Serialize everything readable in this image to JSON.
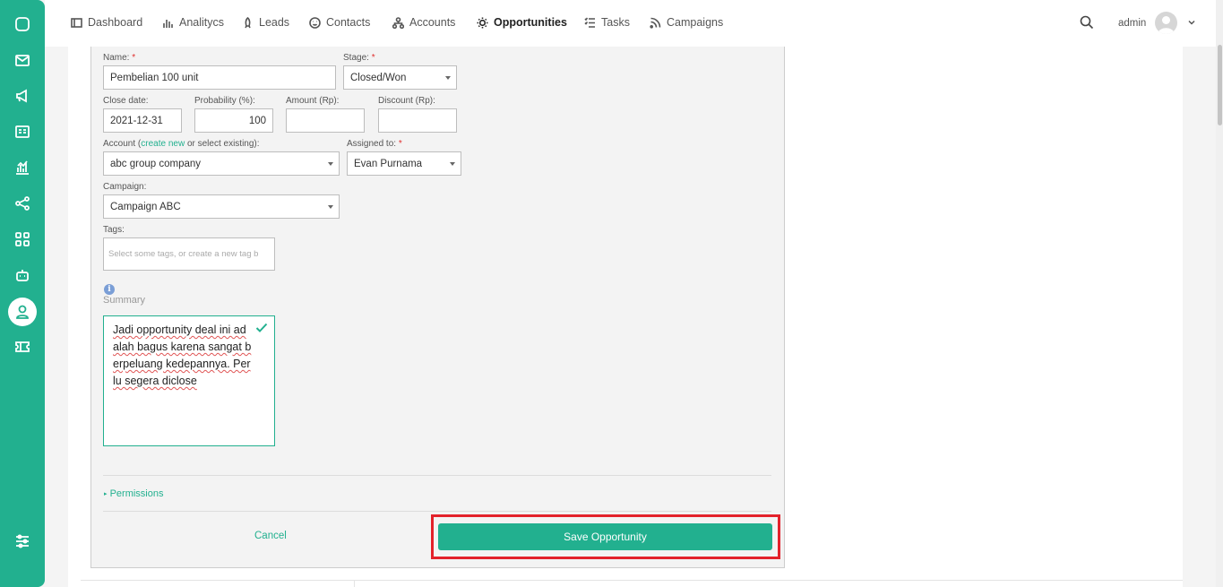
{
  "nav": {
    "items": [
      {
        "label": "Dashboard",
        "icon": "layout-icon"
      },
      {
        "label": "Analitycs",
        "icon": "bar-chart-icon"
      },
      {
        "label": "Leads",
        "icon": "rocket-icon"
      },
      {
        "label": "Contacts",
        "icon": "smiley-icon"
      },
      {
        "label": "Accounts",
        "icon": "hierarchy-icon"
      },
      {
        "label": "Opportunities",
        "icon": "sun-icon",
        "active": true
      },
      {
        "label": "Tasks",
        "icon": "checklist-icon"
      },
      {
        "label": "Campaigns",
        "icon": "rss-icon"
      }
    ],
    "user": "admin"
  },
  "sidebar": {
    "icons": [
      "chat-icon",
      "mail-icon",
      "megaphone-icon",
      "id-card-icon",
      "chart-icon",
      "share-icon",
      "apps-icon",
      "robot-icon",
      "user-icon",
      "ticket-icon",
      "settings-sliders-icon"
    ],
    "active": "user-icon"
  },
  "form": {
    "name_label": "Name:",
    "name_value": "Pembelian 100 unit",
    "stage_label": "Stage:",
    "stage_value": "Closed/Won",
    "close_date_label": "Close date:",
    "close_date_value": "2021-12-31",
    "probability_label": "Probability (%):",
    "probability_value": "100",
    "amount_label": "Amount (Rp):",
    "amount_value": "",
    "discount_label": "Discount (Rp):",
    "discount_value": "",
    "account_label_prefix": "Account (",
    "account_label_link": "create new",
    "account_label_suffix": " or select existing):",
    "account_value": "abc group company",
    "assigned_label": "Assigned to:",
    "assigned_value": "Evan Purnama",
    "campaign_label": "Campaign:",
    "campaign_value": "Campaign ABC",
    "tags_label": "Tags:",
    "tags_placeholder": "Select some tags, or create a new tag b",
    "summary_label": "Summary",
    "summary_text": "Jadi opportunity deal ini adalah bagus karena sangat berpeluang kedepannya. Perlu segera diclose",
    "permissions_label": "Permissions",
    "cancel_label": "Cancel",
    "save_label": "Save Opportunity"
  },
  "colors": {
    "accent": "#22b08f",
    "highlight": "#e3222b",
    "required": "#e0302f"
  }
}
